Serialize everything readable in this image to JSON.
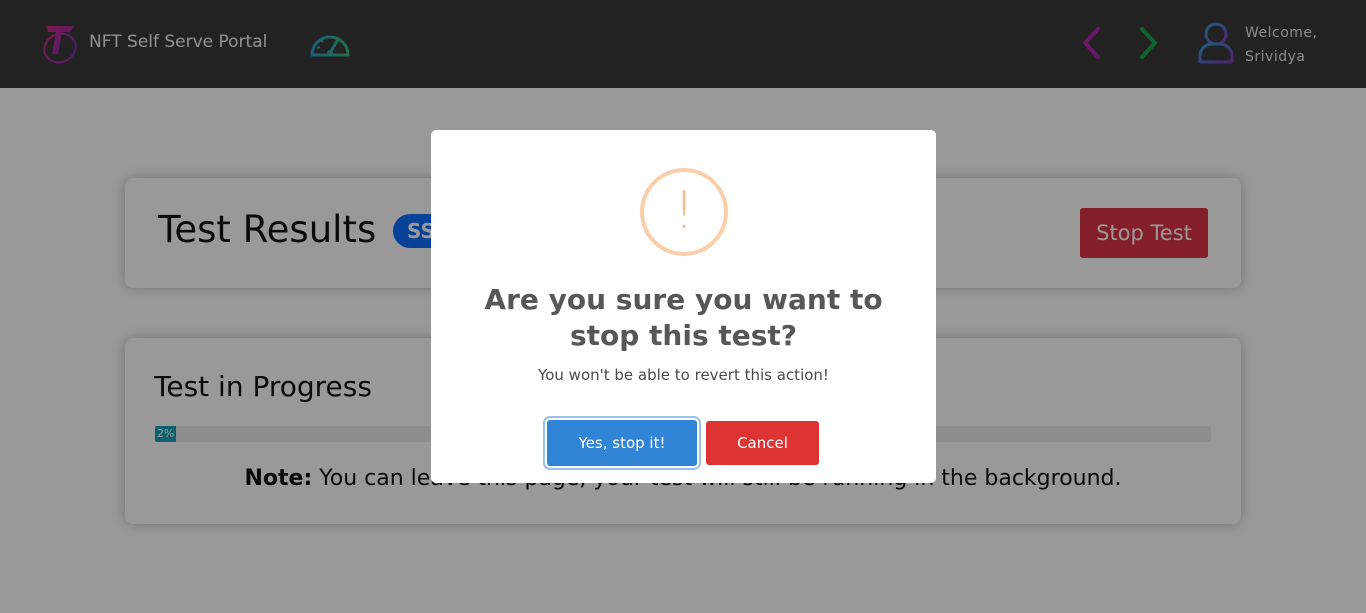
{
  "background_alt": "background slideshow",
  "header": {
    "portal_title": "NFT Self Serve Portal",
    "welcome_line1": "Welcome,",
    "welcome_line2": "Srividya"
  },
  "icons": {
    "logo": "telstra-logo-icon",
    "dashboard": "speedometer-icon",
    "prev": "chevron-left-icon",
    "next": "chevron-right-icon",
    "user": "user-icon"
  },
  "colors": {
    "header_bg": "#3a3a3a",
    "stop_button": "#dc3545",
    "confirm_button": "#3085d6",
    "cancel_button": "#dd3333",
    "warning": "#f8bb86",
    "progress_fill": "#17a2b8",
    "badge": "#0d6efd",
    "nav_prev": "#b027b0",
    "nav_next": "#1aa64b"
  },
  "results": {
    "title": "Test Results",
    "badge": "SS",
    "stop_button": "Stop Test"
  },
  "progress": {
    "title": "Test in Progress",
    "percent_label": "2%",
    "percent_value": 2,
    "note_bold": "Note:",
    "note_text": " You can leave this page, your test will still be running in the background."
  },
  "modal": {
    "icon_glyph": "!",
    "title": "Are you sure you want to stop this test?",
    "text": "You won't be able to revert this action!",
    "confirm_label": "Yes, stop it!",
    "cancel_label": "Cancel"
  }
}
